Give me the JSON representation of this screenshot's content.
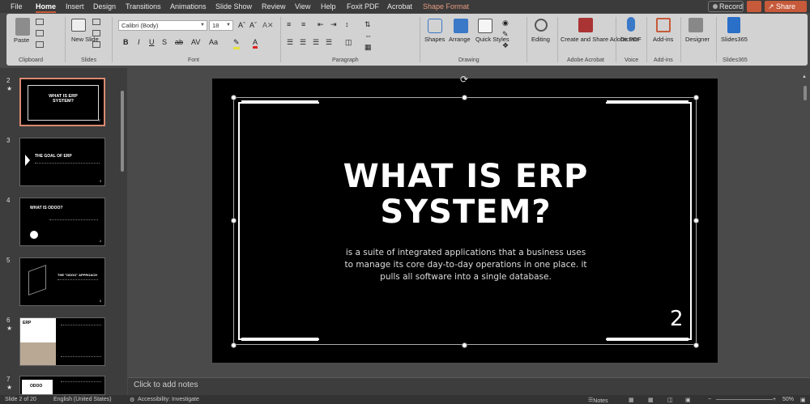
{
  "menu": {
    "tabs": [
      "File",
      "Home",
      "Insert",
      "Design",
      "Transitions",
      "Animations",
      "Slide Show",
      "Review",
      "View",
      "Help",
      "Foxit PDF",
      "Acrobat",
      "Shape Format"
    ],
    "active": "Home",
    "record": "Record",
    "share": "Share"
  },
  "ribbon": {
    "clipboard": {
      "paste": "Paste",
      "label": "Clipboard"
    },
    "slides": {
      "new_slide": "New Slide",
      "label": "Slides"
    },
    "font": {
      "name": "Calibri (Body)",
      "size": "18",
      "label": "Font"
    },
    "paragraph": {
      "label": "Paragraph"
    },
    "drawing": {
      "shapes": "Shapes",
      "arrange": "Arrange",
      "quick_styles": "Quick Styles",
      "label": "Drawing"
    },
    "editing": {
      "label": "Editing"
    },
    "acrobat": {
      "create": "Create and Share Adobe PDF",
      "label": "Adobe Acrobat"
    },
    "voice": {
      "dictate": "Dictate",
      "label": "Voice"
    },
    "addins": {
      "addins": "Add-ins",
      "label": "Add-ins"
    },
    "designer": {
      "label": "Designer"
    },
    "slides365": {
      "label": "Slides365",
      "group": "Slides365"
    }
  },
  "thumbnails": [
    {
      "num": "2",
      "star": true,
      "title": "WHAT IS ERP SYSTEM?",
      "page": "2",
      "selected": true
    },
    {
      "num": "3",
      "star": false,
      "title": "THE GOAL OF ERP",
      "page": "3"
    },
    {
      "num": "4",
      "star": false,
      "title": "WHAT IS ODOO?",
      "page": "4"
    },
    {
      "num": "5",
      "star": false,
      "title": "THE \"ODOO\" APPROACH",
      "page": "5"
    },
    {
      "num": "6",
      "star": true,
      "title": "ERP",
      "page": "6"
    },
    {
      "num": "7",
      "star": true,
      "title": "ODOO",
      "page": "7"
    }
  ],
  "slide": {
    "title": "WHAT IS ERP\nSYSTEM?",
    "body": "is a suite of integrated applications that a business uses to manage its core day-to-day operations in one place. it pulls all software into a single database.",
    "page_number": "2"
  },
  "notes_placeholder": "Click to add notes",
  "status": {
    "slide_of": "Slide 2 of 20",
    "language": "English (United States)",
    "accessibility": "Accessibility: Investigate",
    "notes": "Notes",
    "zoom": "50%"
  },
  "colors": {
    "accent": "#c65a3a",
    "ribbon_bg": "#d2d2d2",
    "app_bg": "#4a4a4a"
  }
}
